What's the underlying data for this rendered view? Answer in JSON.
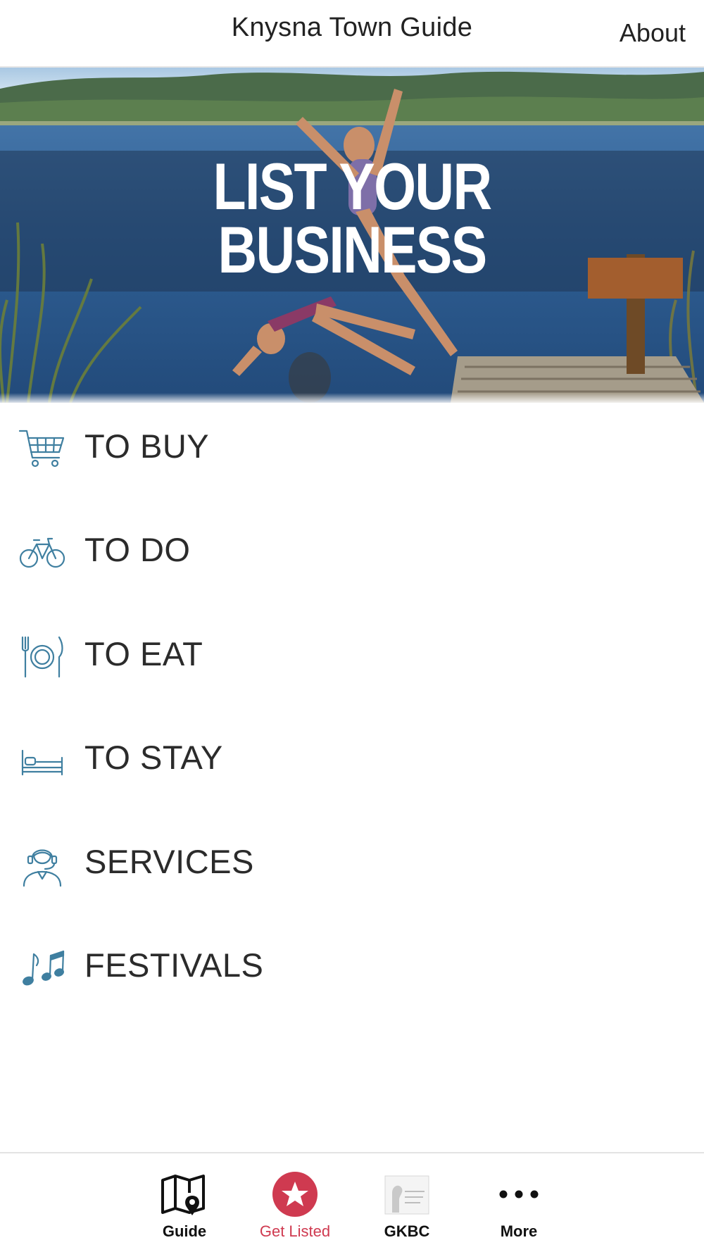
{
  "header": {
    "title": "Knysna Town Guide",
    "about_label": "About"
  },
  "banner": {
    "line1": "LIST YOUR",
    "line2": "BUSINESS"
  },
  "menu": {
    "items": [
      {
        "label": "TO BUY",
        "icon": "shopping-cart-icon"
      },
      {
        "label": "TO DO",
        "icon": "bicycle-icon"
      },
      {
        "label": "TO EAT",
        "icon": "fork-plate-knife-icon"
      },
      {
        "label": "TO STAY",
        "icon": "bed-icon"
      },
      {
        "label": "SERVICES",
        "icon": "support-agent-icon"
      },
      {
        "label": "FESTIVALS",
        "icon": "music-notes-icon"
      }
    ]
  },
  "tabbar": {
    "tabs": [
      {
        "label": "Guide",
        "icon": "map-pin-icon",
        "active": false
      },
      {
        "label": "Get Listed",
        "icon": "star-icon",
        "active": true
      },
      {
        "label": "GKBC",
        "icon": "gkbc-logo-icon",
        "active": false
      },
      {
        "label": "More",
        "icon": "more-dots-icon",
        "active": false
      }
    ]
  },
  "colors": {
    "icon_blue": "#3f7fa0",
    "active_red": "#cf3a50",
    "text_dark": "#2b2b2b"
  }
}
